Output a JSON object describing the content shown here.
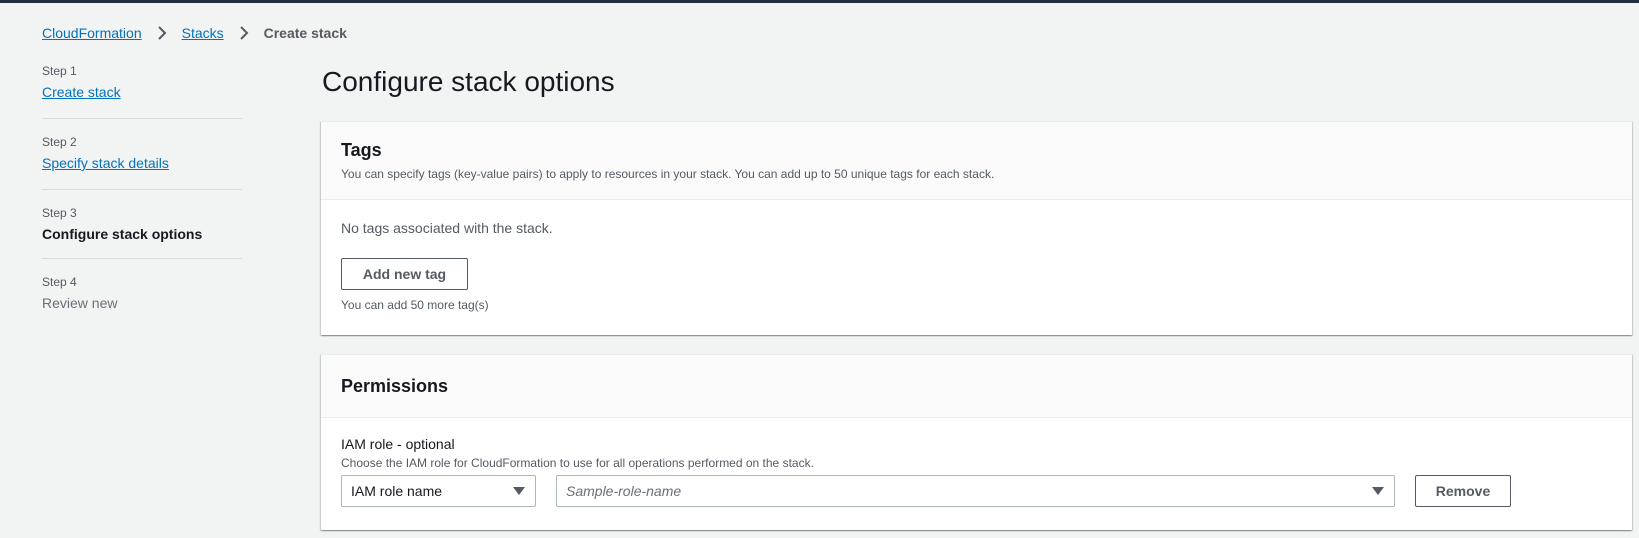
{
  "breadcrumb": {
    "items": [
      "CloudFormation",
      "Stacks"
    ],
    "current": "Create stack"
  },
  "steps": [
    {
      "num": "Step 1",
      "label": "Create stack",
      "state": "link"
    },
    {
      "num": "Step 2",
      "label": "Specify stack details",
      "state": "link"
    },
    {
      "num": "Step 3",
      "label": "Configure stack options",
      "state": "active"
    },
    {
      "num": "Step 4",
      "label": "Review new",
      "state": "disabled"
    }
  ],
  "page": {
    "title": "Configure stack options"
  },
  "tags": {
    "title": "Tags",
    "description": "You can specify tags (key-value pairs) to apply to resources in your stack. You can add up to 50 unique tags for each stack.",
    "empty": "No tags associated with the stack.",
    "add_button": "Add new tag",
    "hint": "You can add 50 more tag(s)"
  },
  "permissions": {
    "title": "Permissions",
    "iam_label": "IAM role - optional",
    "iam_desc": "Choose the IAM role for CloudFormation to use for all operations performed on the stack.",
    "role_type_value": "IAM role name",
    "role_name_placeholder": "Sample-role-name",
    "remove_button": "Remove"
  },
  "icons": {
    "separator": "chevron-right-icon",
    "dropdown": "caret-down-icon"
  },
  "colors": {
    "link": "#0073bb",
    "topbar": "#232f3e",
    "background": "#f2f3f3"
  }
}
